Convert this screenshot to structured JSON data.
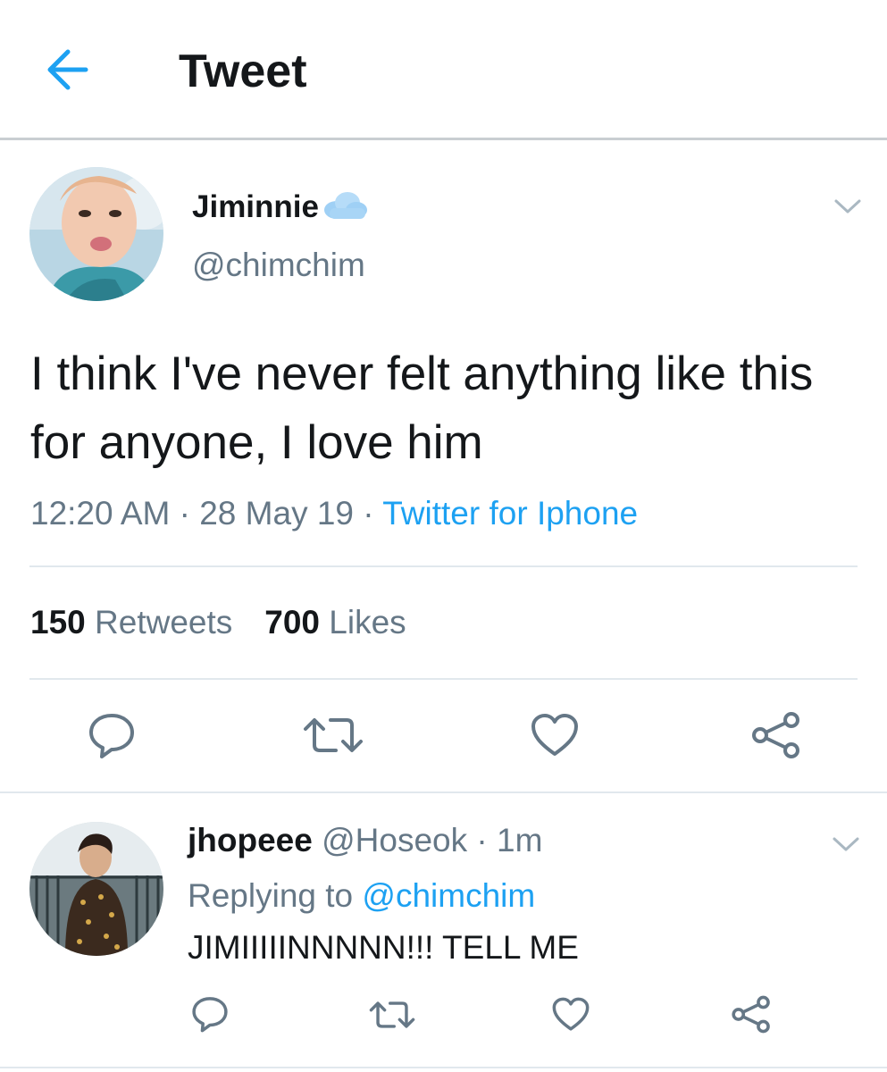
{
  "header": {
    "title": "Tweet"
  },
  "tweet": {
    "author": {
      "display_name": "Jiminnie",
      "name_emoji": "cloud-icon",
      "handle": "@chimchim"
    },
    "text": "I think I've never felt anything like this for anyone, I love him",
    "time": "12:20 AM",
    "date": "28 May 19",
    "source": "Twitter for Iphone",
    "separator": "·",
    "retweets_count": "150",
    "retweets_label": "Retweets",
    "likes_count": "700",
    "likes_label": "Likes"
  },
  "reply": {
    "display_name": "jhopeee",
    "handle": "@Hoseok",
    "separator": "·",
    "time": "1m",
    "replying_prefix": "Replying to",
    "replying_to": "@chimchim",
    "text": "JIMIIIIINNNNN!!! TELL ME"
  },
  "icons": {
    "back": "arrow-left-icon",
    "caret": "chevron-down-icon",
    "reply": "comment-icon",
    "retweet": "retweet-icon",
    "like": "heart-icon",
    "share": "share-icon"
  },
  "colors": {
    "accent": "#1da1f2",
    "icon_gray": "#657786",
    "text": "#14171a",
    "divider": "#e1e8ed"
  }
}
